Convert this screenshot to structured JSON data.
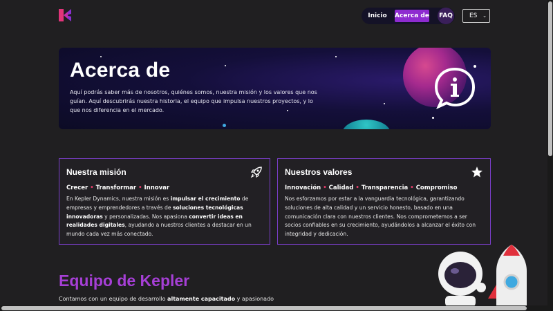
{
  "nav": {
    "items": [
      {
        "label": "Inicio"
      },
      {
        "label": "Acerca de",
        "active": true
      },
      {
        "label": "FAQ"
      }
    ],
    "language": "ES"
  },
  "hero": {
    "title": "Acerca de",
    "description": "Aquí podrás saber más de nosotros, quiénes somos, nuestra misión y los valores que nos guían. Aquí descubrirás nuestra historia, el equipo que impulsa nuestros proyectos, y lo que nos diferencia en el mercado."
  },
  "mision": {
    "title": "Nuestra misión",
    "icon": "rocket-icon",
    "tags": [
      "Crecer",
      "Transformar",
      "Innovar"
    ],
    "body": [
      {
        "t": "En Kepler Dynamics, nuestra misión es ",
        "b": false
      },
      {
        "t": "impulsar el crecimiento",
        "b": true
      },
      {
        "t": " de empresas y emprendedores a través de ",
        "b": false
      },
      {
        "t": "soluciones tecnológicas innovadoras",
        "b": true
      },
      {
        "t": " y personalizadas. Nos apasiona ",
        "b": false
      },
      {
        "t": "convertir ideas en realidades digitales",
        "b": true
      },
      {
        "t": ", ayudando a nuestros clientes a destacar en un mundo cada vez más conectado.",
        "b": false
      }
    ]
  },
  "valores": {
    "title": "Nuestros valores",
    "icon": "star-icon",
    "tags": [
      "Innovación",
      "Calidad",
      "Transparencia",
      "Compromiso"
    ],
    "body": "Nos esforzamos por estar a la vanguardia tecnológica, garantizando soluciones de alta calidad y un servicio honesto, basado en una comunicación clara con nuestros clientes. Nos comprometemos a ser socios confiables en su crecimiento, ayudándolos a alcanzar el éxito con integridad y dedicación."
  },
  "team": {
    "title": "Equipo de Kepler",
    "desc_pre": "Contamos con un equipo de desarrollo ",
    "desc_bold": "altamente capacitado",
    "desc_post": " y apasionado por"
  },
  "colors": {
    "accent": "#8e2bd0",
    "tag_separator": "#e23d6a",
    "card_border": "#7a3ec9",
    "team_title": "#a63fd6",
    "background": "#201f21"
  }
}
